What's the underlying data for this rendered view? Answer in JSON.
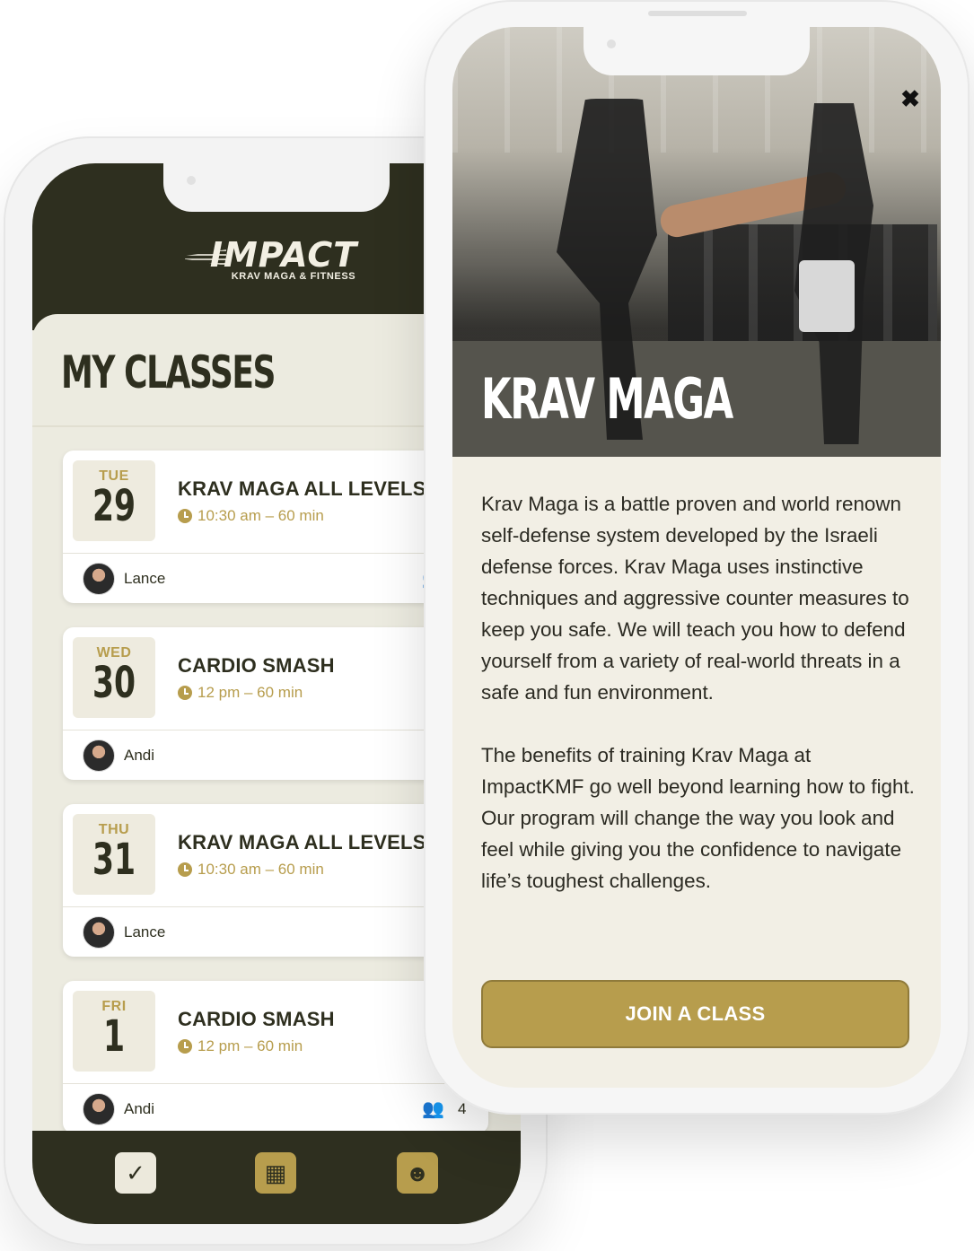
{
  "left_phone": {
    "brand": {
      "name": "IMPACT",
      "tagline": "KRAV MAGA & FITNESS"
    },
    "page_title": "MY CLASSES",
    "classes": [
      {
        "dow": "TUE",
        "day": "29",
        "name": "KRAV MAGA ALL LEVELS",
        "time": "10:30 am – 60 min",
        "instructor": "Lance",
        "attendees": ""
      },
      {
        "dow": "WED",
        "day": "30",
        "name": "CARDIO SMASH",
        "time": "12 pm – 60 min",
        "instructor": "Andi",
        "attendees": ""
      },
      {
        "dow": "THU",
        "day": "31",
        "name": "KRAV MAGA ALL LEVELS",
        "time": "10:30 am – 60 min",
        "instructor": "Lance",
        "attendees": ""
      },
      {
        "dow": "FRI",
        "day": "1",
        "name": "CARDIO SMASH",
        "time": "12 pm – 60 min",
        "instructor": "Andi",
        "attendees": "4"
      }
    ],
    "nav": [
      {
        "icon": "calendar-check-icon",
        "active": true
      },
      {
        "icon": "calendar-grid-icon",
        "active": false
      },
      {
        "icon": "contact-card-icon",
        "active": false
      }
    ]
  },
  "right_phone": {
    "title": "KRAV MAGA",
    "description": [
      "Krav Maga is a battle proven and world renown self-defense system developed by the Israeli defense forces. Krav Maga uses instinctive techniques and aggressive counter measures to keep you safe. We will teach you how to defend yourself from a variety of real-world threats in a safe and fun environment.",
      "The benefits of training Krav Maga at ImpactKMF go well beyond learning how to fight. Our program will change the way you look and feel while giving you the confidence to navigate life’s toughest challenges."
    ],
    "cta_label": "JOIN A CLASS",
    "close_label": "✖"
  },
  "colors": {
    "dark_olive": "#2e2f1f",
    "gold": "#b79d4d",
    "cream": "#ecebe0"
  }
}
